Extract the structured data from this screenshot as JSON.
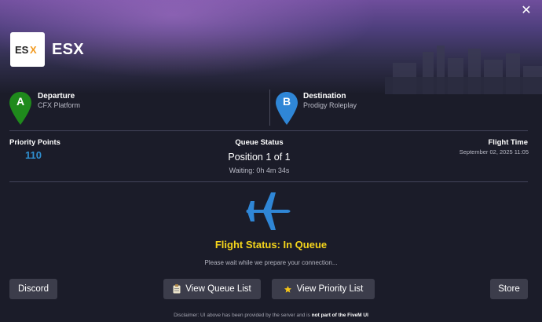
{
  "header": {
    "logo_text": "ESX",
    "server_name": "ESX",
    "close_glyph": "✕"
  },
  "route": {
    "departure": {
      "marker": "A",
      "title": "Departure",
      "name": "CFX Platform",
      "color": "#1f8a1c"
    },
    "destination": {
      "marker": "B",
      "title": "Destination",
      "name": "Prodigy Roleplay",
      "color": "#2f86d6"
    }
  },
  "stats": {
    "priority_label": "Priority Points",
    "priority_value": "110",
    "queue_label": "Queue Status",
    "queue_position": "Position 1 of 1",
    "waiting": "Waiting: 0h 4m 34s",
    "flight_time_label": "Flight Time",
    "flight_time_value": "September 02, 2025 11:05"
  },
  "status": {
    "icon": "airplane-icon",
    "title": "Flight Status: In Queue",
    "subtitle": "Please wait while we prepare your connection...",
    "accent": "#f5d51b"
  },
  "buttons": {
    "discord": "Discord",
    "queue_list": "View Queue List",
    "priority_list": "View Priority List",
    "store": "Store"
  },
  "disclaimer": {
    "prefix": "Disclaimer: UI above has been provided by the server and is ",
    "emphasis": "not part of the FiveM UI"
  }
}
